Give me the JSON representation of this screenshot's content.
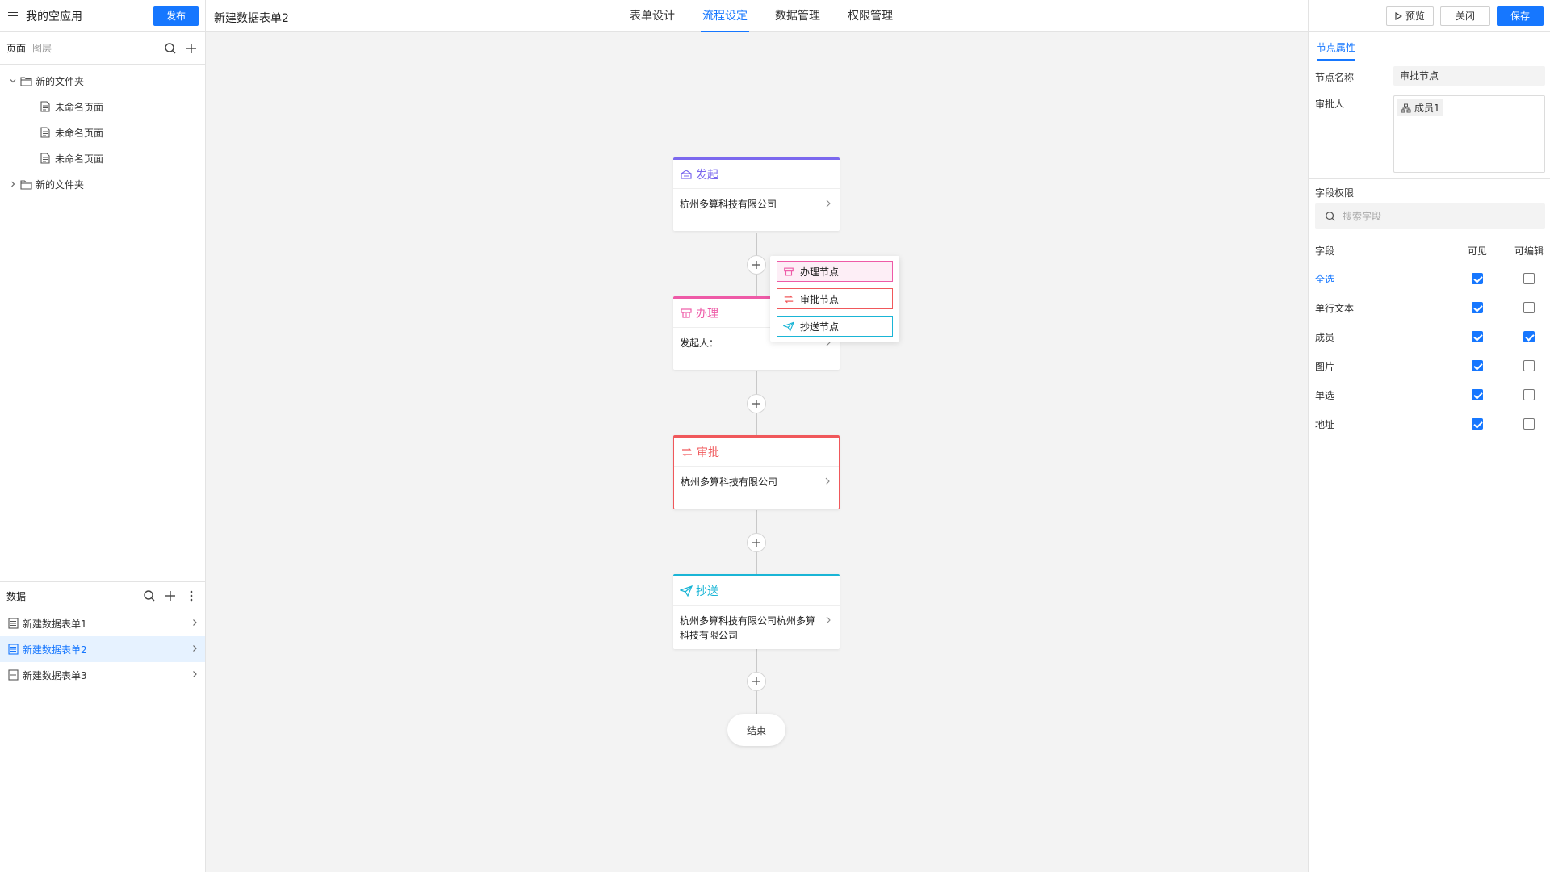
{
  "app": {
    "title": "我的空应用",
    "publish_label": "发布"
  },
  "pages_pane": {
    "tab_pages": "页面",
    "tab_layers": "图层"
  },
  "tree": [
    {
      "label": "新的文件夹",
      "type": "folder",
      "expanded": true
    },
    {
      "label": "未命名页面",
      "type": "page"
    },
    {
      "label": "未命名页面",
      "type": "page"
    },
    {
      "label": "未命名页面",
      "type": "page"
    },
    {
      "label": "新的文件夹",
      "type": "folder",
      "expanded": false
    }
  ],
  "data_pane": {
    "title": "数据",
    "items": [
      {
        "label": "新建数据表单1",
        "selected": false
      },
      {
        "label": "新建数据表单2",
        "selected": true
      },
      {
        "label": "新建数据表单3",
        "selected": false
      }
    ]
  },
  "topbar": {
    "doc_title": "新建数据表单2",
    "tabs": [
      {
        "label": "表单设计",
        "active": false
      },
      {
        "label": "流程设定",
        "active": true
      },
      {
        "label": "数据管理",
        "active": false
      },
      {
        "label": "权限管理",
        "active": false
      }
    ]
  },
  "flow": {
    "start": {
      "title": "发起",
      "content": "杭州多算科技有限公司",
      "color": "#7b68ee"
    },
    "handle": {
      "title": "办理",
      "content": "发起人：",
      "color": "#ee5aa7"
    },
    "approve": {
      "title": "审批",
      "content": "杭州多算科技有限公司",
      "color": "#f0585b"
    },
    "cc": {
      "title": "抄送",
      "content": "杭州多算科技有限公司杭州多算科技有限公司",
      "color": "#1ab5d6"
    },
    "end_label": "结束",
    "popup": [
      {
        "label": "办理节点",
        "color": "#ee5aa7",
        "bg": "#fdeef6"
      },
      {
        "label": "审批节点",
        "color": "#f0585b",
        "bg": "#ffffff"
      },
      {
        "label": "抄送节点",
        "color": "#1ab5d6",
        "bg": "#ffffff"
      }
    ]
  },
  "right_panel": {
    "preview_label": "预览",
    "close_label": "关闭",
    "save_label": "保存",
    "tab_label": "节点属性",
    "node_name_label": "节点名称",
    "node_name_value": "审批节点",
    "approver_label": "审批人",
    "approver_tag": "成员1",
    "field_perm_label": "字段权限",
    "search_placeholder": "搜索字段",
    "col_field": "字段",
    "col_visible": "可见",
    "col_editable": "可编辑",
    "fields": [
      {
        "name": "全选",
        "visible": true,
        "editable": false,
        "highlight": true
      },
      {
        "name": "单行文本",
        "visible": true,
        "editable": false
      },
      {
        "name": "成员",
        "visible": true,
        "editable": true
      },
      {
        "name": "图片",
        "visible": true,
        "editable": false
      },
      {
        "name": "单选",
        "visible": true,
        "editable": false
      },
      {
        "name": "地址",
        "visible": true,
        "editable": false
      }
    ]
  },
  "colors": {
    "accent": "#1677ff",
    "selected_bg": "#e6f2ff",
    "canvas_bg": "#f3f3f3"
  }
}
